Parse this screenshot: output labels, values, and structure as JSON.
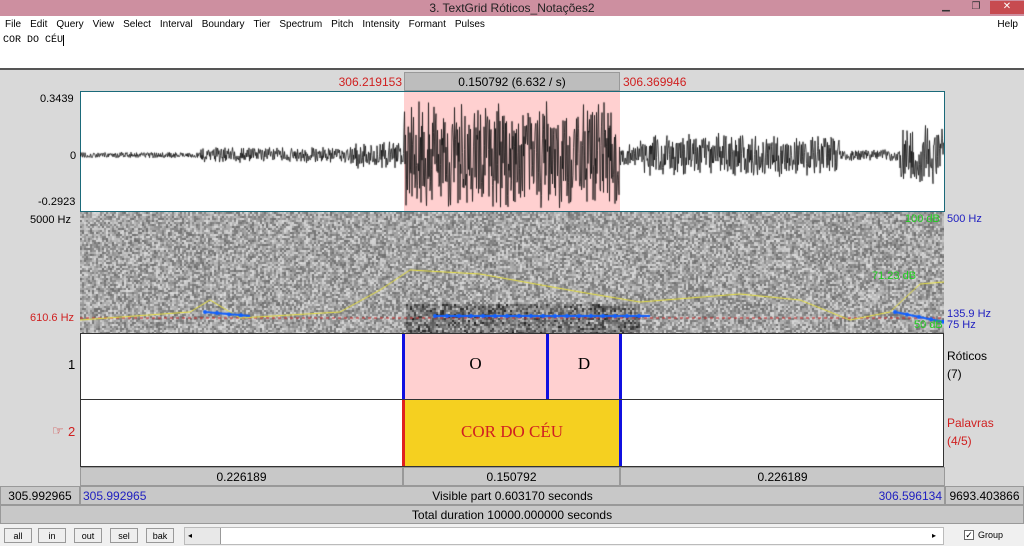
{
  "window": {
    "title": "3. TextGrid Róticos_Notações2"
  },
  "menu": [
    "File",
    "Edit",
    "Query",
    "View",
    "Select",
    "Interval",
    "Boundary",
    "Tier",
    "Spectrum",
    "Pitch",
    "Intensity",
    "Formant",
    "Pulses"
  ],
  "help": "Help",
  "text_field": "COR DO CÉU",
  "selection": {
    "start": "306.219153",
    "duration": "0.150792 (6.632 / s)",
    "end": "306.369946"
  },
  "waveform": {
    "max": "0.3439",
    "zero": "0",
    "min": "-0.2923"
  },
  "spectrogram": {
    "top": "5000 Hz",
    "cursor": "610.6 Hz",
    "intensity_top": "100 dB",
    "intensity_mid": "71.23 dB",
    "intensity_bottom": "50 dB",
    "pitch_top": "500 Hz",
    "pitch_value": "135.9 Hz",
    "pitch_bottom": "75 Hz"
  },
  "tiers": [
    {
      "number": "1",
      "name": "Róticos",
      "count": "(7)",
      "intervals": [
        "O",
        "D"
      ]
    },
    {
      "number": "2",
      "name": "Palavras",
      "count": "(4/5)",
      "pointer": "☞",
      "intervals": [
        "COR DO CÉU"
      ]
    }
  ],
  "durations": [
    "0.226189",
    "0.150792",
    "0.226189"
  ],
  "visible": {
    "left_outer": "305.992965",
    "left": "305.992965",
    "label": "Visible part 0.603170 seconds",
    "right": "306.596134",
    "right_outer": "9693.403866"
  },
  "total": "Total duration 10000.000000 seconds",
  "buttons": [
    "all",
    "in",
    "out",
    "sel",
    "bak"
  ],
  "group": {
    "label": "Group",
    "checked": true
  },
  "colors": {
    "selection": "#ffd0d0",
    "word_interval": "#f5d020",
    "boundary": "#1010e0",
    "titlebar": "#cd8fa0"
  }
}
